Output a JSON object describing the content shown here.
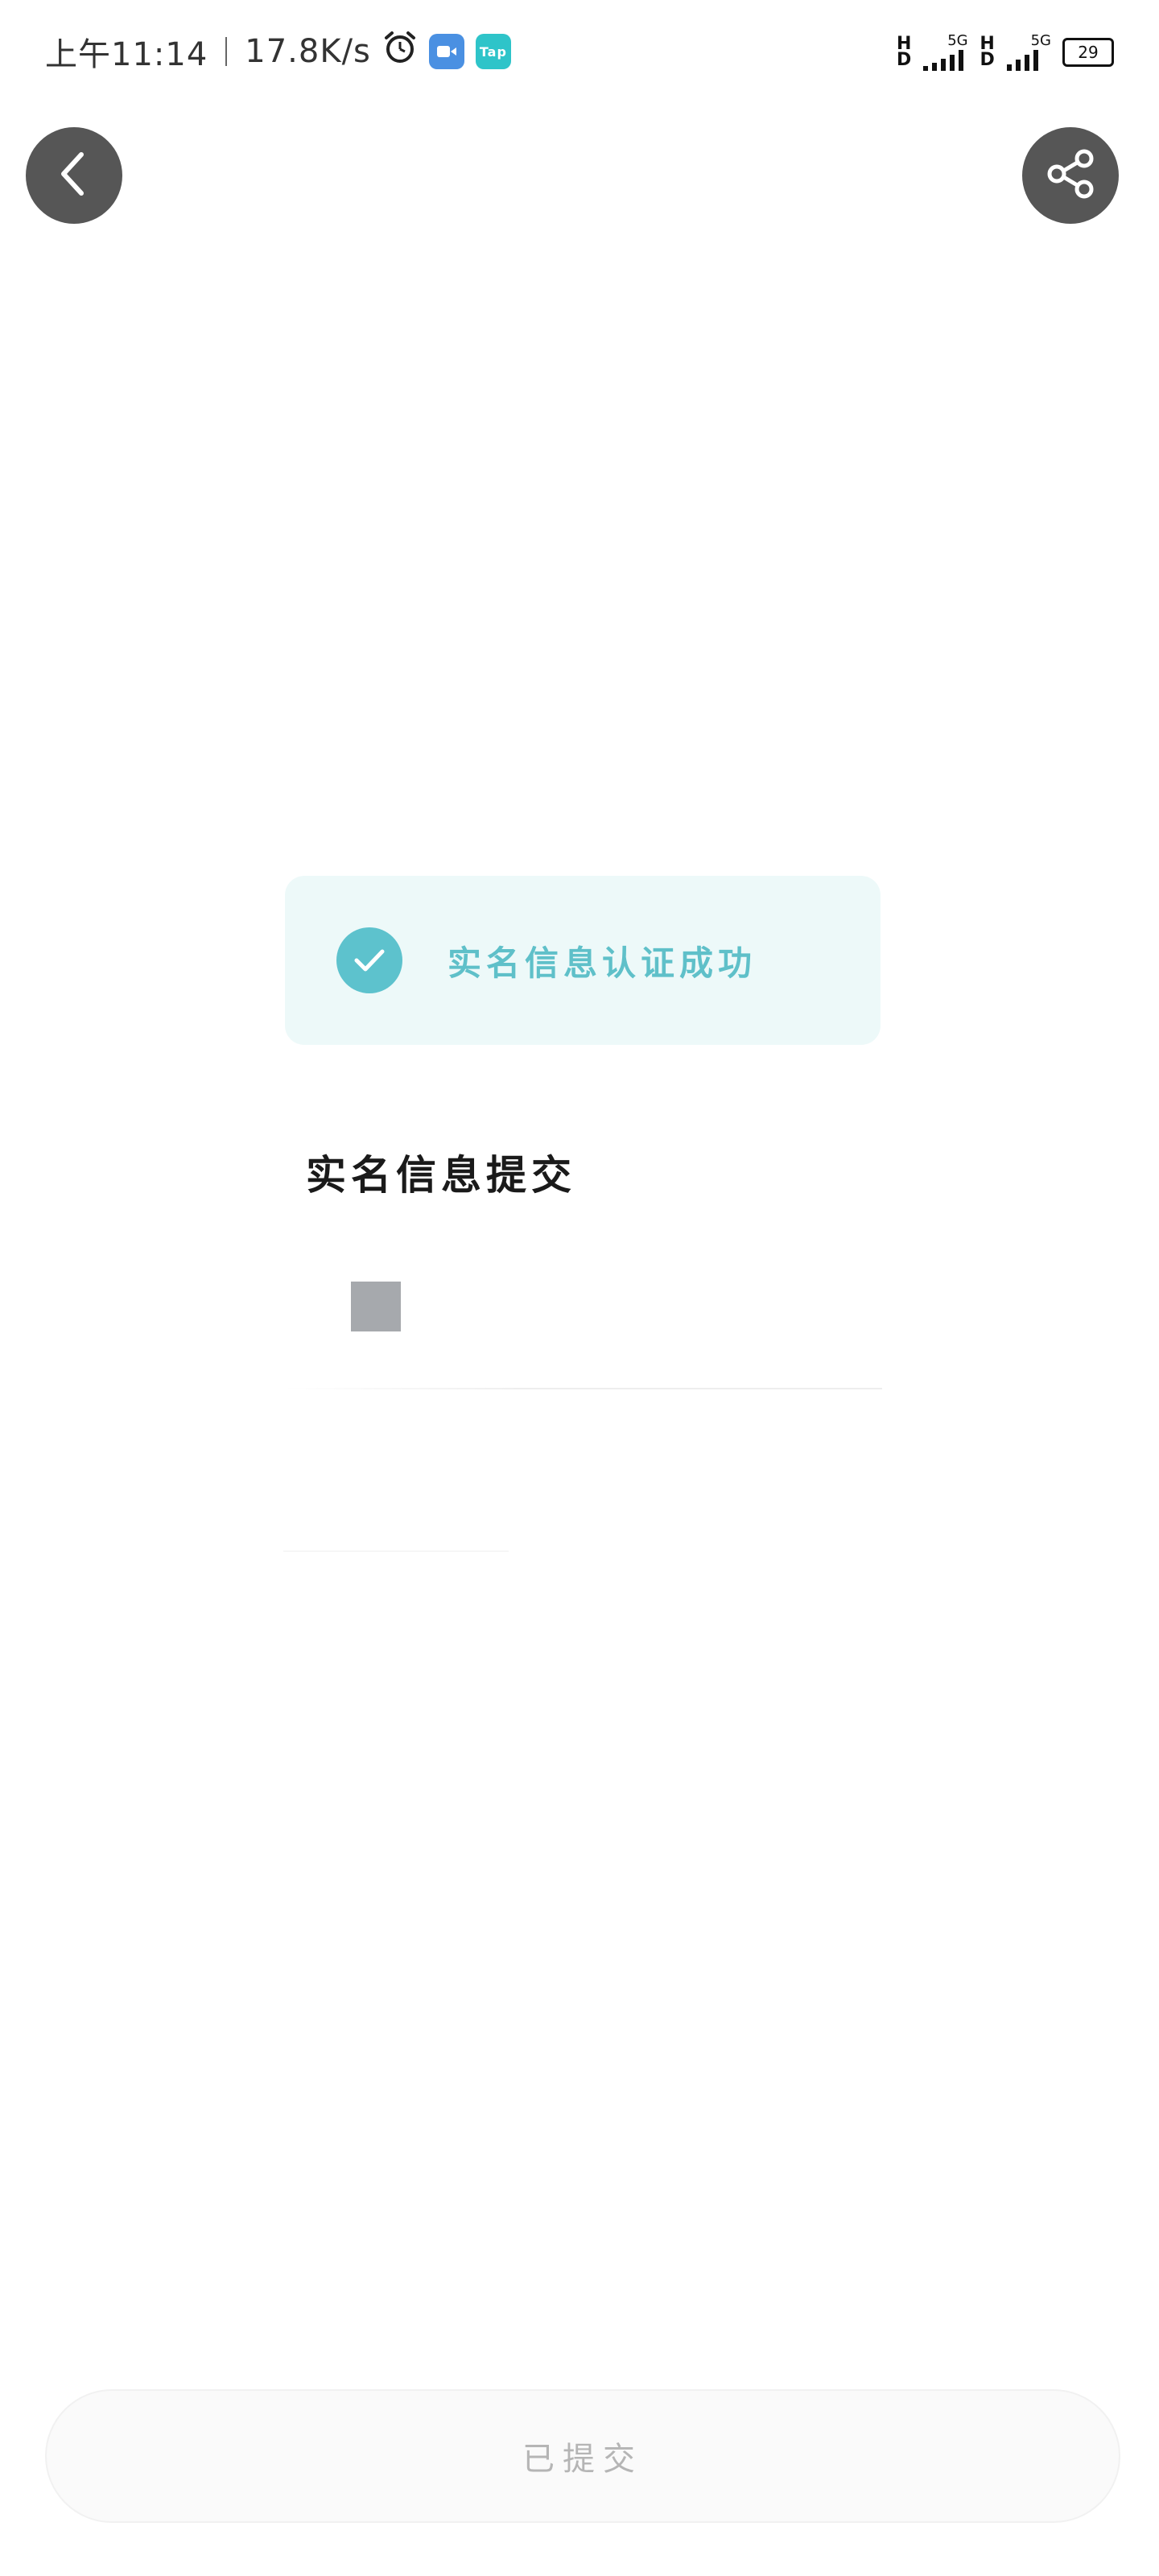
{
  "status_bar": {
    "time": "上午11:14",
    "net_speed": "17.8K/s",
    "badge_video_icon": "video-camera-icon",
    "badge_tap_label": "Tap",
    "hd1": "H D",
    "network1": "5G",
    "hd2": "H D",
    "network2": "5G",
    "battery": "29"
  },
  "header": {
    "back_icon": "chevron-left-icon",
    "share_icon": "share-icon"
  },
  "success_banner": {
    "text": "实名信息认证成功",
    "accent_color": "#5dc2cd"
  },
  "section": {
    "title": "实名信息提交"
  },
  "footer": {
    "submit_label": "已提交"
  }
}
